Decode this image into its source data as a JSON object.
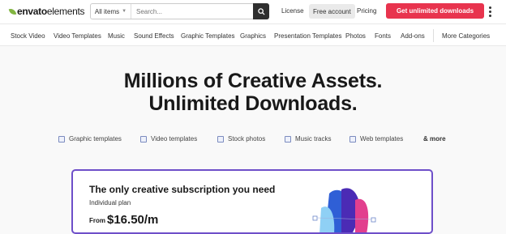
{
  "header": {
    "logo_brand": "envato",
    "logo_product": "elements",
    "search_category": "All items",
    "search_placeholder": "Search...",
    "license": "License",
    "free_account": "Free account",
    "pricing": "Pricing",
    "cta": "Get unlimited downloads"
  },
  "categories": [
    "Stock Video",
    "Video Templates",
    "Music",
    "Sound Effects",
    "Graphic Templates",
    "Graphics",
    "Presentation Templates",
    "Photos",
    "Fonts",
    "Add-ons",
    "More Categories"
  ],
  "hero": {
    "line1": "Millions of Creative Assets.",
    "line2": "Unlimited Downloads."
  },
  "chips": [
    "Graphic templates",
    "Video templates",
    "Stock photos",
    "Music tracks",
    "Web templates"
  ],
  "chips_more": "& more",
  "card": {
    "title": "The only creative subscription you need",
    "subtitle": "Individual plan",
    "from": "From",
    "price": "$16.50/m"
  },
  "colors": {
    "cta": "#e8344e",
    "card_border": "#6e4fc9",
    "logo_leaf": "#82b541"
  }
}
